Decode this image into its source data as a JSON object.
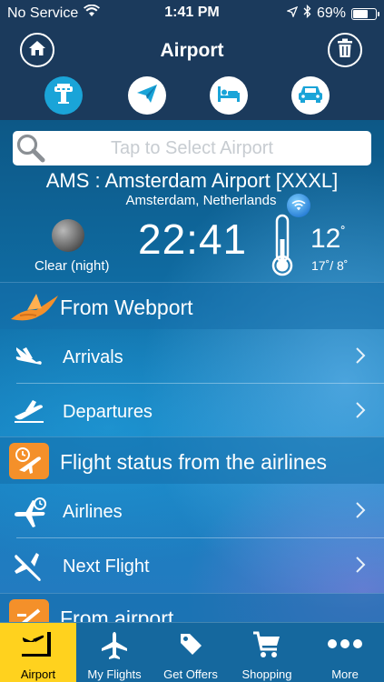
{
  "status_bar": {
    "carrier": "No Service",
    "time": "1:41 PM",
    "battery": "69%",
    "battery_level": 0.69
  },
  "header": {
    "title": "Airport",
    "home_icon": "home-icon",
    "trash_icon": "trash-icon"
  },
  "modes": [
    {
      "icon": "control-tower-icon",
      "active": true
    },
    {
      "icon": "paper-plane-icon",
      "active": false
    },
    {
      "icon": "hotel-bed-icon",
      "active": false
    },
    {
      "icon": "car-icon",
      "active": false
    }
  ],
  "search": {
    "placeholder": "Tap to Select Airport"
  },
  "airport": {
    "code_name": "AMS : Amsterdam Airport [XXXL]",
    "city": "Amsterdam, Netherlands"
  },
  "weather": {
    "condition": "Clear (night)",
    "time": "22:41",
    "temp": "12",
    "range": "17˚/ 8˚",
    "degree": "˚"
  },
  "sections": [
    {
      "label": "From Webport",
      "icon": "bird-logo-icon"
    },
    {
      "label": "Flight status from the airlines",
      "icon": "airport-clock-icon"
    },
    {
      "label": "From airport",
      "icon": "airport-building-icon"
    }
  ],
  "rows": [
    {
      "label": "Arrivals",
      "icon": "plane-landing-icon"
    },
    {
      "label": "Departures",
      "icon": "plane-takeoff-icon"
    },
    {
      "label": "Airlines",
      "icon": "plane-clock-icon"
    },
    {
      "label": "Next Flight",
      "icon": "plane-icon"
    }
  ],
  "tabs": [
    {
      "label": "Airport",
      "icon": "airport-tab-icon",
      "active": true
    },
    {
      "label": "My Flights",
      "icon": "plane-tab-icon",
      "active": false
    },
    {
      "label": "Get Offers",
      "icon": "tag-icon",
      "active": false
    },
    {
      "label": "Shopping",
      "icon": "cart-icon",
      "active": false
    },
    {
      "label": "More",
      "icon": "more-dots-icon",
      "active": false
    }
  ],
  "colors": {
    "header_bg": "#1b3a5c",
    "accent_blue": "#1aa4d8",
    "orange": "#f4902a",
    "tab_active": "#ffd21e"
  }
}
